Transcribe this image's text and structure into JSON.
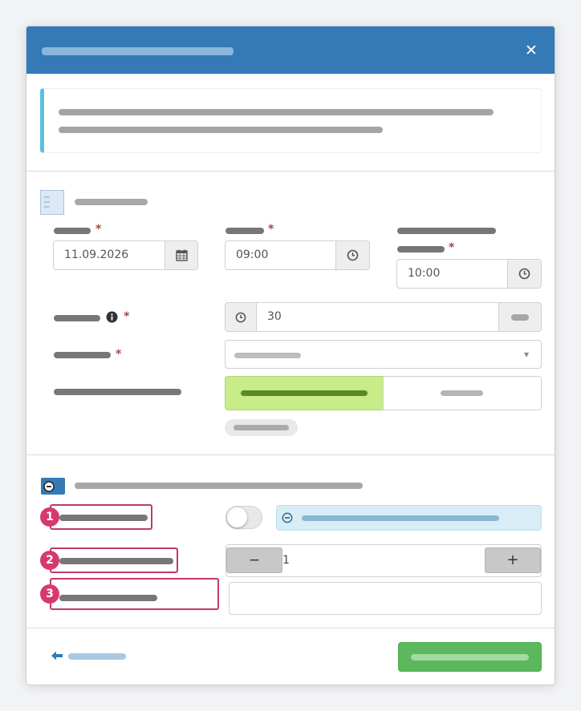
{
  "dialog": {
    "close_glyph": "✕",
    "close_icon": "close-icon"
  },
  "section1": {
    "icon": "list-document-icon",
    "date": {
      "value": "11.09.2026",
      "icon": "calendar-icon"
    },
    "time_start": {
      "value": "09:00",
      "icon": "clock-icon"
    },
    "time_end": {
      "value": "10:00",
      "icon": "clock-icon"
    },
    "duration": {
      "value": "30",
      "icon": "clock-icon",
      "info_icon": "info-circle-icon"
    },
    "select": {
      "caret": "▾"
    },
    "toggle_group": {
      "active_index": 0
    },
    "required_mark": "*"
  },
  "section2": {
    "icon": "minus-circle-icon",
    "badges": [
      "1",
      "2",
      "3"
    ],
    "switch": {
      "on": false
    },
    "info_bar_icon": "minus-circle-icon",
    "stepper": {
      "value": "1",
      "minus": "−",
      "plus": "+"
    }
  },
  "footer": {
    "back_icon": "arrow-left-icon"
  },
  "colors": {
    "header": "#337ab7",
    "callout_accent": "#5bc0de",
    "required": "#a94442",
    "toggle_active": "#c8ec88",
    "submit": "#5cb85c",
    "badge": "#d63a6d",
    "info_bar": "#d9edf7"
  }
}
